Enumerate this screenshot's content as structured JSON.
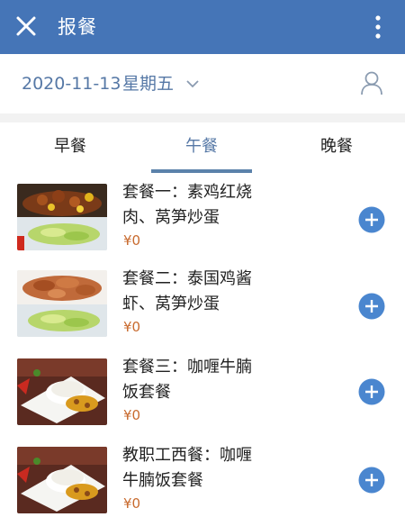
{
  "header": {
    "title": "报餐"
  },
  "datebar": {
    "date": "2020-11-13",
    "weekday": "星期五"
  },
  "tabs": [
    {
      "label": "早餐",
      "active": false
    },
    {
      "label": "午餐",
      "active": true
    },
    {
      "label": "晚餐",
      "active": false
    }
  ],
  "meals": [
    {
      "name": "套餐一：素鸡红烧肉、莴笋炒蛋",
      "price": "¥0",
      "image": "braised-pork-and-lettuce"
    },
    {
      "name": "套餐二：泰国鸡酱虾、莴笋炒蛋",
      "price": "¥0",
      "image": "shrimp-and-lettuce"
    },
    {
      "name": "套餐三：咖喱牛腩饭套餐",
      "price": "¥0",
      "image": "curry-beef-rice"
    },
    {
      "name": "教职工西餐：咖喱牛腩饭套餐",
      "price": "¥0",
      "image": "curry-beef-rice"
    }
  ],
  "colors": {
    "header": "#4575b7",
    "accent": "#5678a6",
    "price": "#c86a2e",
    "add_button": "#4a86cf"
  },
  "icons": {
    "close": "close-icon",
    "more": "more-vertical-icon",
    "chevron": "chevron-down-icon",
    "user": "user-icon",
    "add": "plus-circle-icon"
  }
}
